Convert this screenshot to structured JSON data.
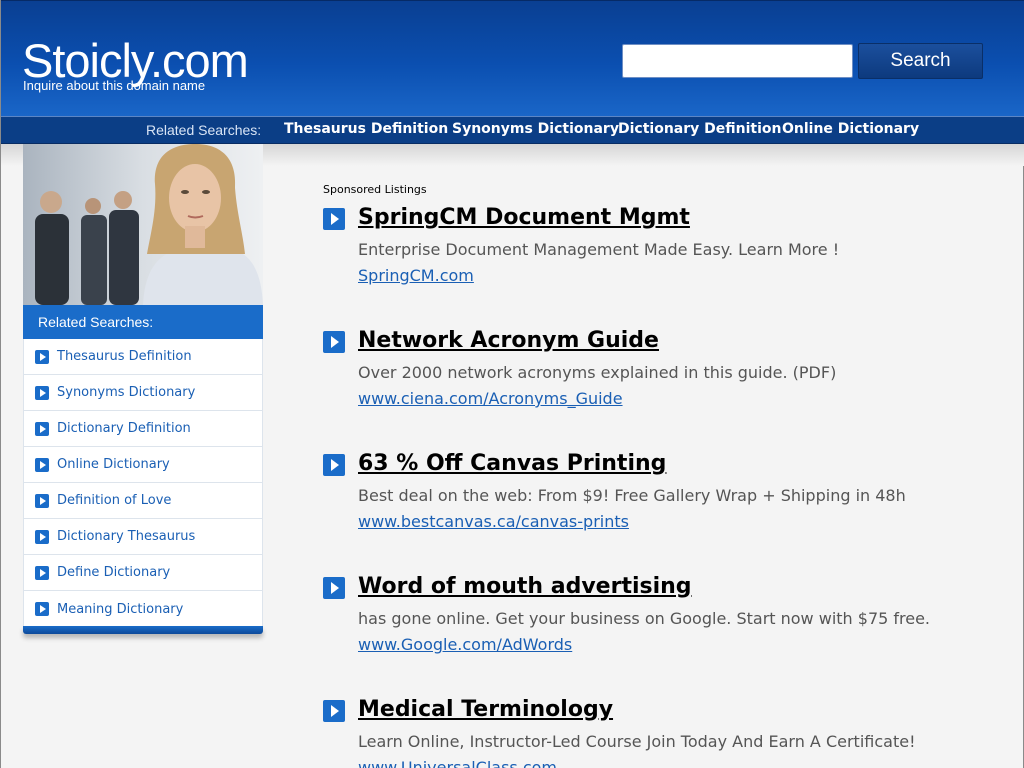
{
  "header": {
    "logo": "Stoicly.com",
    "tagline": "Inquire about this domain name",
    "search_placeholder": "",
    "search_button": "Search"
  },
  "topbar": {
    "label": "Related Searches:",
    "links": [
      "Thesaurus Definition",
      "Synonyms Dictionary",
      "Dictionary Definition",
      "Online Dictionary"
    ]
  },
  "sidebar": {
    "heading": "Related Searches:",
    "items": [
      "Thesaurus Definition",
      "Synonyms Dictionary",
      "Dictionary Definition",
      "Online Dictionary",
      "Definition of Love",
      "Dictionary Thesaurus",
      "Define Dictionary",
      "Meaning Dictionary"
    ]
  },
  "main": {
    "sponsored_label": "Sponsored Listings",
    "listings": [
      {
        "title": "SpringCM Document Mgmt",
        "desc": "Enterprise Document Management Made Easy. Learn More !",
        "url": "SpringCM.com"
      },
      {
        "title": "Network Acronym Guide",
        "desc": "Over 2000 network acronyms explained in this guide. (PDF)",
        "url": "www.ciena.com/Acronyms_Guide"
      },
      {
        "title": "63 % Off Canvas Printing",
        "desc": "Best deal on the web: From $9! Free Gallery Wrap + Shipping in 48h",
        "url": "www.bestcanvas.ca/canvas-prints"
      },
      {
        "title": "Word of mouth advertising",
        "desc": "has gone online. Get your business on Google. Start now with $75 free.",
        "url": "www.Google.com/AdWords"
      },
      {
        "title": "Medical Terminology",
        "desc": "Learn Online, Instructor-Led Course Join Today And Earn A Certificate!",
        "url": "www.UniversalClass.com"
      }
    ]
  },
  "colors": {
    "header_blue": "#0b4fb0",
    "bar_blue": "#0b3e86",
    "accent_blue": "#1a6cc9",
    "link_blue": "#1a5fb4"
  }
}
